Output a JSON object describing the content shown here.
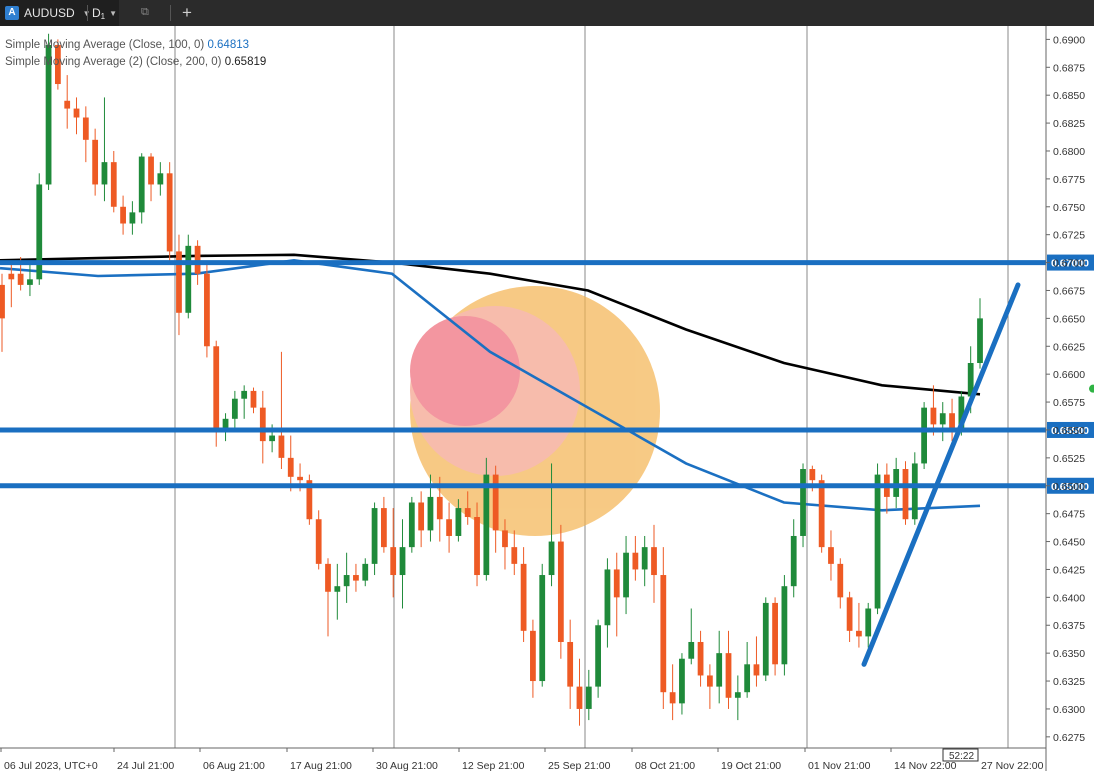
{
  "tabs": [
    {
      "icon": "A",
      "label": "AUDUSD"
    },
    {
      "label": "D",
      "sub": "1"
    }
  ],
  "indicators": [
    {
      "label": "Simple Moving Average (Close, 100, 0)",
      "value": "0.64813",
      "color": "#1b70c2"
    },
    {
      "label": "Simple Moving Average (2) (Close, 200, 0)",
      "value": "0.65819",
      "color": "#000000"
    }
  ],
  "chart_data": {
    "type": "candlestick",
    "symbol": "AUDUSD",
    "timeframe": "D1",
    "ylim": [
      0.6265,
      0.6912
    ],
    "y_ticks": [
      "0.6900",
      "0.6875",
      "0.6850",
      "0.6825",
      "0.6800",
      "0.6775",
      "0.6750",
      "0.6725",
      "0.6700",
      "0.6675",
      "0.6650",
      "0.6625",
      "0.6600",
      "0.6575",
      "0.6550",
      "0.6525",
      "0.6500",
      "0.6475",
      "0.6450",
      "0.6425",
      "0.6400",
      "0.6375",
      "0.6350",
      "0.6325",
      "0.6300",
      "0.6275"
    ],
    "x_labels": [
      "06 Jul 2023, UTC+0",
      "24 Jul 21:00",
      "06 Aug 21:00",
      "17 Aug 21:00",
      "30 Aug 21:00",
      "12 Sep 21:00",
      "25 Sep 21:00",
      "08 Oct 21:00",
      "19 Oct 21:00",
      "01 Nov 21:00",
      "14 Nov 22:00",
      "27 Nov 22:00"
    ],
    "vertical_separators": [
      "24 Jul",
      "30 Aug",
      "25 Sep",
      "01 Nov",
      "27 Nov"
    ],
    "horizontal_levels": [
      {
        "value": 0.67,
        "label": "0.67000",
        "color": "#1a6fc1"
      },
      {
        "value": 0.655,
        "label": "0.65500",
        "color": "#1a6fc1"
      },
      {
        "value": 0.65,
        "label": "0.65000",
        "color": "#1a6fc1"
      }
    ],
    "trendline": {
      "from": {
        "candle": 0,
        "price": 0.634
      },
      "to": {
        "candle": 1,
        "price": 0.668
      },
      "color": "#1a6fc1"
    },
    "time_marker": "52:22",
    "candles": [
      [
        0.668,
        0.669,
        0.662,
        0.665
      ],
      [
        0.669,
        0.67,
        0.666,
        0.6685
      ],
      [
        0.669,
        0.6705,
        0.6675,
        0.668
      ],
      [
        0.668,
        0.67,
        0.667,
        0.6685
      ],
      [
        0.6685,
        0.678,
        0.668,
        0.677
      ],
      [
        0.677,
        0.6905,
        0.6765,
        0.6895
      ],
      [
        0.6895,
        0.69,
        0.6855,
        0.686
      ],
      [
        0.6845,
        0.6868,
        0.682,
        0.6838
      ],
      [
        0.6838,
        0.6848,
        0.6815,
        0.683
      ],
      [
        0.683,
        0.684,
        0.679,
        0.681
      ],
      [
        0.681,
        0.682,
        0.676,
        0.677
      ],
      [
        0.677,
        0.6848,
        0.6755,
        0.679
      ],
      [
        0.679,
        0.68,
        0.6745,
        0.675
      ],
      [
        0.675,
        0.676,
        0.6725,
        0.6735
      ],
      [
        0.6735,
        0.6755,
        0.6725,
        0.6745
      ],
      [
        0.6745,
        0.6798,
        0.6735,
        0.6795
      ],
      [
        0.6795,
        0.6798,
        0.6755,
        0.677
      ],
      [
        0.677,
        0.679,
        0.676,
        0.678
      ],
      [
        0.678,
        0.679,
        0.67,
        0.671
      ],
      [
        0.671,
        0.6725,
        0.6635,
        0.6655
      ],
      [
        0.6655,
        0.6725,
        0.665,
        0.6715
      ],
      [
        0.6715,
        0.672,
        0.668,
        0.669
      ],
      [
        0.669,
        0.67,
        0.6615,
        0.6625
      ],
      [
        0.6625,
        0.663,
        0.6535,
        0.655
      ],
      [
        0.655,
        0.6565,
        0.654,
        0.656
      ],
      [
        0.656,
        0.6585,
        0.655,
        0.6578
      ],
      [
        0.6578,
        0.659,
        0.656,
        0.6585
      ],
      [
        0.6585,
        0.6588,
        0.6565,
        0.657
      ],
      [
        0.657,
        0.6585,
        0.652,
        0.654
      ],
      [
        0.654,
        0.6555,
        0.653,
        0.6545
      ],
      [
        0.6545,
        0.662,
        0.6515,
        0.6525
      ],
      [
        0.6525,
        0.6545,
        0.6495,
        0.6508
      ],
      [
        0.6508,
        0.652,
        0.6495,
        0.6505
      ],
      [
        0.6505,
        0.651,
        0.6465,
        0.647
      ],
      [
        0.647,
        0.6478,
        0.6425,
        0.643
      ],
      [
        0.643,
        0.6435,
        0.6365,
        0.6405
      ],
      [
        0.6405,
        0.643,
        0.638,
        0.641
      ],
      [
        0.641,
        0.644,
        0.6395,
        0.642
      ],
      [
        0.642,
        0.643,
        0.6405,
        0.6415
      ],
      [
        0.6415,
        0.6435,
        0.641,
        0.643
      ],
      [
        0.643,
        0.6485,
        0.642,
        0.648
      ],
      [
        0.648,
        0.649,
        0.644,
        0.6445
      ],
      [
        0.6445,
        0.648,
        0.64,
        0.642
      ],
      [
        0.642,
        0.647,
        0.639,
        0.6445
      ],
      [
        0.6445,
        0.649,
        0.644,
        0.6485
      ],
      [
        0.6485,
        0.6495,
        0.6445,
        0.646
      ],
      [
        0.646,
        0.651,
        0.645,
        0.649
      ],
      [
        0.649,
        0.6508,
        0.645,
        0.647
      ],
      [
        0.647,
        0.6485,
        0.644,
        0.6455
      ],
      [
        0.6455,
        0.6488,
        0.645,
        0.648
      ],
      [
        0.648,
        0.6495,
        0.6465,
        0.6472
      ],
      [
        0.6472,
        0.6485,
        0.641,
        0.642
      ],
      [
        0.642,
        0.6525,
        0.6415,
        0.651
      ],
      [
        0.651,
        0.6518,
        0.644,
        0.646
      ],
      [
        0.646,
        0.647,
        0.6425,
        0.6445
      ],
      [
        0.6445,
        0.646,
        0.642,
        0.643
      ],
      [
        0.643,
        0.6445,
        0.636,
        0.637
      ],
      [
        0.637,
        0.638,
        0.631,
        0.6325
      ],
      [
        0.6325,
        0.643,
        0.632,
        0.642
      ],
      [
        0.642,
        0.652,
        0.641,
        0.645
      ],
      [
        0.645,
        0.6465,
        0.6345,
        0.636
      ],
      [
        0.636,
        0.638,
        0.63,
        0.632
      ],
      [
        0.632,
        0.6345,
        0.6285,
        0.63
      ],
      [
        0.63,
        0.6335,
        0.629,
        0.632
      ],
      [
        0.632,
        0.638,
        0.631,
        0.6375
      ],
      [
        0.6375,
        0.6435,
        0.6355,
        0.6425
      ],
      [
        0.6425,
        0.644,
        0.6365,
        0.64
      ],
      [
        0.64,
        0.6455,
        0.6385,
        0.644
      ],
      [
        0.644,
        0.6455,
        0.6415,
        0.6425
      ],
      [
        0.6425,
        0.6455,
        0.641,
        0.6445
      ],
      [
        0.6445,
        0.6465,
        0.6395,
        0.642
      ],
      [
        0.642,
        0.6445,
        0.63,
        0.6315
      ],
      [
        0.6315,
        0.634,
        0.629,
        0.6305
      ],
      [
        0.6305,
        0.635,
        0.6295,
        0.6345
      ],
      [
        0.6345,
        0.639,
        0.634,
        0.636
      ],
      [
        0.636,
        0.637,
        0.632,
        0.633
      ],
      [
        0.633,
        0.634,
        0.63,
        0.632
      ],
      [
        0.632,
        0.637,
        0.6305,
        0.635
      ],
      [
        0.635,
        0.637,
        0.63,
        0.631
      ],
      [
        0.631,
        0.633,
        0.629,
        0.6315
      ],
      [
        0.6315,
        0.636,
        0.631,
        0.634
      ],
      [
        0.634,
        0.6365,
        0.632,
        0.633
      ],
      [
        0.633,
        0.64,
        0.6325,
        0.6395
      ],
      [
        0.6395,
        0.64,
        0.633,
        0.634
      ],
      [
        0.634,
        0.642,
        0.633,
        0.641
      ],
      [
        0.641,
        0.647,
        0.64,
        0.6455
      ],
      [
        0.6455,
        0.652,
        0.6445,
        0.6515
      ],
      [
        0.6515,
        0.6518,
        0.6495,
        0.6505
      ],
      [
        0.6505,
        0.651,
        0.644,
        0.6445
      ],
      [
        0.6445,
        0.646,
        0.6415,
        0.643
      ],
      [
        0.643,
        0.6435,
        0.639,
        0.64
      ],
      [
        0.64,
        0.6405,
        0.636,
        0.637
      ],
      [
        0.637,
        0.6395,
        0.6355,
        0.6365
      ],
      [
        0.6365,
        0.6395,
        0.6355,
        0.639
      ],
      [
        0.639,
        0.652,
        0.6385,
        0.651
      ],
      [
        0.651,
        0.652,
        0.6475,
        0.649
      ],
      [
        0.649,
        0.6525,
        0.648,
        0.6515
      ],
      [
        0.6515,
        0.6522,
        0.6465,
        0.647
      ],
      [
        0.647,
        0.653,
        0.6465,
        0.652
      ],
      [
        0.652,
        0.6575,
        0.6515,
        0.657
      ],
      [
        0.657,
        0.659,
        0.6545,
        0.6555
      ],
      [
        0.6555,
        0.6575,
        0.654,
        0.6565
      ],
      [
        0.6565,
        0.6578,
        0.654,
        0.6552
      ],
      [
        0.6552,
        0.6585,
        0.6545,
        0.658
      ],
      [
        0.658,
        0.6625,
        0.6565,
        0.661
      ],
      [
        0.661,
        0.6668,
        0.6605,
        0.665
      ]
    ],
    "sma100": [
      0.6695,
      0.6688,
      0.669,
      0.6702,
      0.669,
      0.662,
      0.657,
      0.652,
      0.6485,
      0.6478,
      0.6482
    ],
    "sma200": [
      0.6702,
      0.6704,
      0.6706,
      0.6707,
      0.67,
      0.669,
      0.6675,
      0.664,
      0.661,
      0.659,
      0.6582
    ]
  }
}
